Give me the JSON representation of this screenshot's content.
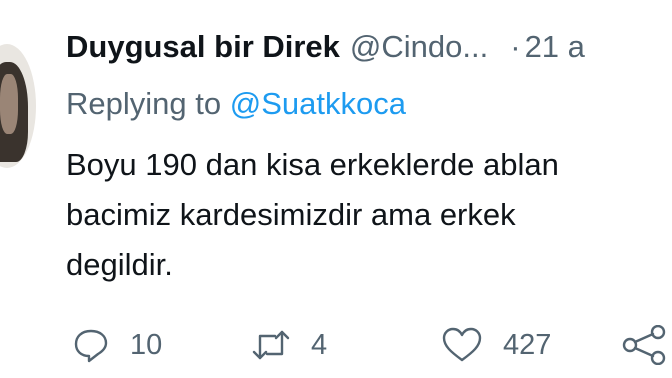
{
  "tweet": {
    "author_name": "Duygusal bir Direk",
    "author_handle": "@Cindo...",
    "separator": "·",
    "time": "21 a",
    "reply_prefix": "Replying to",
    "reply_to": "@Suatkkoca",
    "body_lines": [
      "Boyu 190 dan kisa erkeklerde ablan",
      "bacimiz kardesimizdir ama erkek",
      "degildir."
    ]
  },
  "actions": {
    "reply_count": "10",
    "retweet_count": "4",
    "like_count": "427",
    "icons": [
      "speech-bubble-icon",
      "retweet-icon",
      "heart-icon",
      "share-icon"
    ]
  },
  "colors": {
    "text": "#0f1419",
    "secondary": "#536471",
    "mention": "#1d9bf0"
  }
}
